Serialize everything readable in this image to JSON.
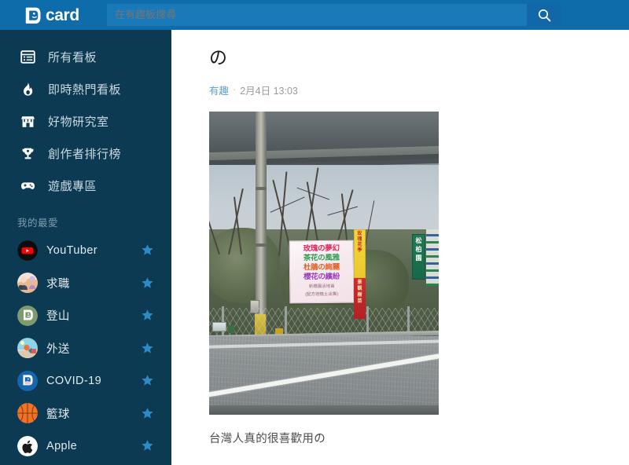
{
  "header": {
    "logo_text": "card",
    "logo_icon": "dcard-logo-icon",
    "search_placeholder": "在有趣板搜尋",
    "search_value": "",
    "search_icon": "search-icon"
  },
  "sidebar": {
    "nav": [
      {
        "label": "所有看板",
        "icon": "list-board-icon"
      },
      {
        "label": "即時熱門看板",
        "icon": "flame-icon"
      },
      {
        "label": "好物研究室",
        "icon": "store-icon"
      },
      {
        "label": "創作者排行榜",
        "icon": "trophy-icon"
      },
      {
        "label": "遊戲專區",
        "icon": "gamepad-icon"
      }
    ],
    "favorites_title": "我的最愛",
    "favorites": [
      {
        "label": "YouTuber",
        "avatar": "youtube-avatar",
        "star": "star-icon"
      },
      {
        "label": "求職",
        "avatar": "jobs-avatar",
        "star": "star-icon"
      },
      {
        "label": "登山",
        "avatar": "hiking-avatar",
        "star": "star-icon"
      },
      {
        "label": "外送",
        "avatar": "delivery-avatar",
        "star": "star-icon"
      },
      {
        "label": "COVID-19",
        "avatar": "covid-avatar",
        "star": "star-icon"
      },
      {
        "label": "籃球",
        "avatar": "basketball-avatar",
        "star": "star-icon"
      },
      {
        "label": "Apple",
        "avatar": "apple-avatar",
        "star": "star-icon"
      }
    ]
  },
  "post": {
    "title": "の",
    "board": "有趣",
    "separator": "·",
    "date": "2月4日 13:03",
    "body": "台灣人真的很喜歡用の",
    "photo": {
      "alt": "路邊花卉園圃廣告布條，位於高架橋下",
      "banner_lines": [
        "玫瑰の夢幻",
        "茶花の風雅",
        "杜鵑の絢麗",
        "櫻花の繽紛"
      ],
      "banner_sub_1": "新橋園活地苗",
      "banner_sub_2": "(配方培植土出售)",
      "yellow_sign_chars": [
        "玫",
        "瑰",
        "花",
        "季"
      ],
      "red_sign_chars": [
        "景",
        "觀",
        "樹",
        "苗"
      ],
      "green_sign_chars": [
        "松",
        "柏",
        "園"
      ]
    }
  },
  "colors": {
    "header_blue": "#0f6cab",
    "search_field": "#1a79b8",
    "sidebar_navy": "#0c3a52",
    "board_link": "#5c9ecb",
    "star_blue": "#2e8ac4",
    "body_text": "#4b4b4b"
  }
}
